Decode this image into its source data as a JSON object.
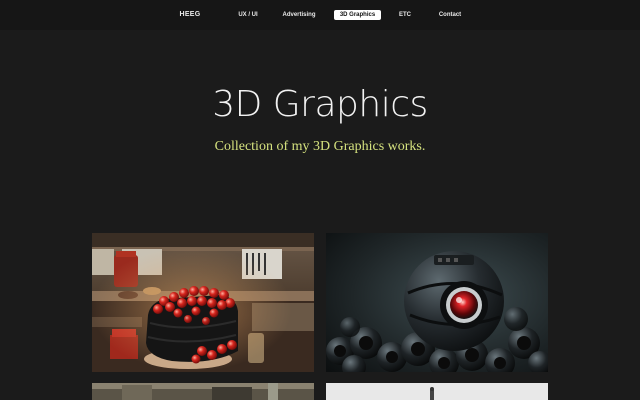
{
  "nav": {
    "logo": "HEEG",
    "items": [
      {
        "label": "UX / UI"
      },
      {
        "label": "Advertising"
      },
      {
        "label": "3D Graphics"
      },
      {
        "label": "ETC"
      },
      {
        "label": "Contact"
      }
    ],
    "active_item": "3D Graphics"
  },
  "hero": {
    "title": "3D Graphics",
    "subtitle": "Collection of my 3D Graphics works."
  },
  "gallery": {
    "items": [
      {
        "subject": "sushi-restaurant-render"
      },
      {
        "subject": "robot-eye-cameras-render"
      },
      {
        "subject": "partial-render-bottom-left"
      },
      {
        "subject": "partial-render-bottom-right"
      }
    ]
  },
  "colors": {
    "background": "#1b1b1b",
    "nav_background": "#161616",
    "subtitle_accent": "#d6e37f",
    "active_pill": "#ffffff"
  }
}
